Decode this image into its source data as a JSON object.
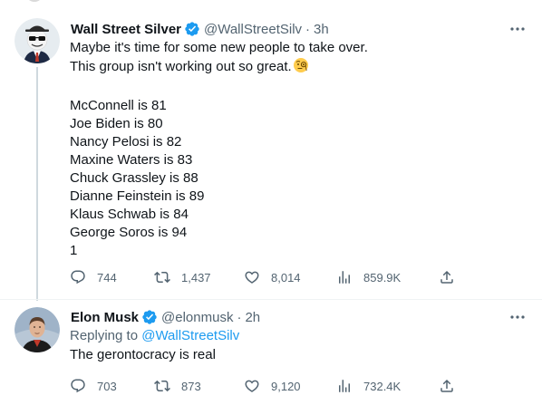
{
  "tweets": [
    {
      "author_name": "Wall Street Silver",
      "handle": "@WallStreetSilv",
      "separator": "·",
      "time": "3h",
      "lines": [
        "Maybe it's time for some new people to take over.",
        "This group isn't working out so great.",
        "",
        "McConnell is 81",
        "Joe Biden is 80",
        "Nancy Pelosi is 82",
        "Maxine Waters is 83",
        "Chuck Grassley is 88",
        "Dianne Feinstein is 89",
        "Klaus Schwab is 84",
        "George Soros is 94",
        "1"
      ],
      "emoji_icon": "monocle-face-icon",
      "replies": "744",
      "retweets": "1,437",
      "likes": "8,014",
      "views": "859.9K"
    },
    {
      "author_name": "Elon Musk",
      "handle": "@elonmusk",
      "separator": "·",
      "time": "2h",
      "replying_prefix": "Replying to",
      "replying_handle": "@WallStreetSilv",
      "text": "The gerontocracy is real",
      "replies": "703",
      "retweets": "873",
      "likes": "9,120",
      "views": "732.4K"
    }
  ],
  "colors": {
    "text": "#0f1419",
    "secondary": "#536471",
    "accent": "#1d9bf0",
    "verified": "#1d9bf0",
    "divider": "#eff3f4",
    "thread_line": "#cfd9de"
  },
  "icons": [
    "verified-badge-icon",
    "more-dots-icon",
    "reply-icon",
    "retweet-icon",
    "like-icon",
    "views-icon",
    "share-icon"
  ]
}
